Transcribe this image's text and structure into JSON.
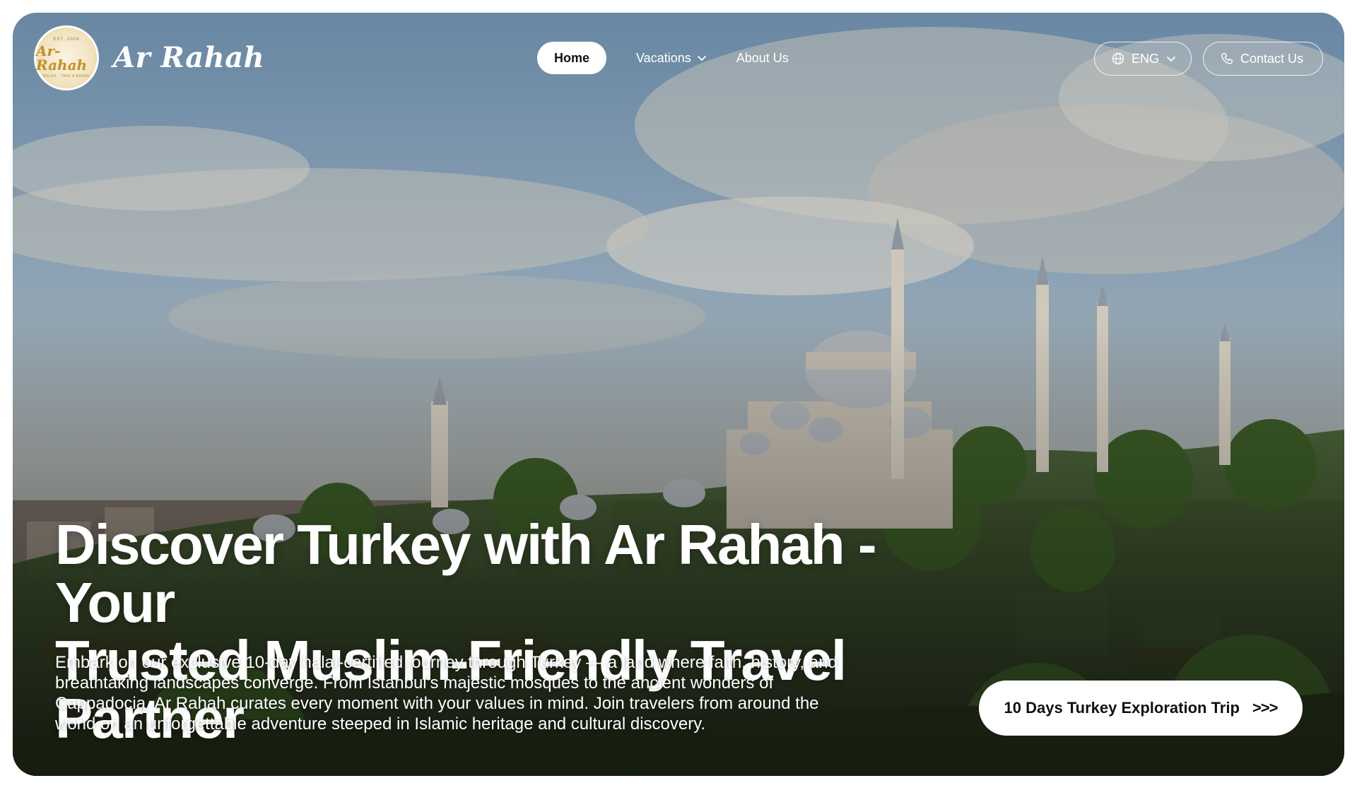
{
  "brand": {
    "name": "Ar Rahah",
    "logo": {
      "script_text": "Ar-Rahah",
      "est_text": "EST. 2024",
      "tagline": "RELAX · TAKE A BREAK"
    }
  },
  "nav": {
    "home": "Home",
    "vacations": "Vacations",
    "about": "About Us"
  },
  "language": {
    "label": "ENG",
    "icon": "globe-icon"
  },
  "contact": {
    "label": "Contact Us",
    "icon": "phone-icon"
  },
  "hero": {
    "headline_line1": "Discover Turkey with Ar Rahah - Your",
    "headline_line2": "Trusted Muslim-Friendly Travel Partner",
    "description": "Embark on our exclusive 10-day halal-certified journey through Turkey — a land where faith, history, and breathtaking landscapes converge. From Istanbul’s majestic mosques to the ancient wonders of Cappadocia, Ar Rahah curates every moment with your values in mind. Join travelers from around the world on an unforgettable adventure steeped in Islamic heritage and cultural discovery.",
    "cta_label": "10 Days Turkey Exploration Trip",
    "cta_arrows": ">>>"
  },
  "colors": {
    "accent_button_bg": "#ffffff",
    "text_on_image": "#ffffff",
    "logo_gold": "#c0922a"
  }
}
